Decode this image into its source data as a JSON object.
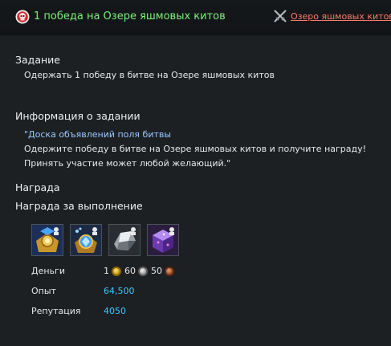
{
  "header": {
    "title": "1 победа на Озере яшмовых китов",
    "location_link": "Озеро яшмовых китов",
    "title_icon": "red-skull-icon",
    "location_icon": "crossed-swords-icon"
  },
  "objective": {
    "heading": "Задание",
    "text": "Одержать 1 победу в битве на Озере яшмовых китов"
  },
  "quest_info": {
    "heading": "Информация о задании",
    "link_text": "\"Доска объявлений поля битвы",
    "line2": "Одержите победу в битве на Озере яшмовых китов и получите награду!",
    "line3": "Принять участие может любой желающий.\""
  },
  "reward": {
    "heading": "Награда",
    "completion_heading": "Награда за выполнение",
    "items": [
      {
        "name": "gold-medal-chest-icon"
      },
      {
        "name": "blue-crest-chest-icon"
      },
      {
        "name": "silver-ore-icon"
      },
      {
        "name": "purple-cube-icon"
      }
    ],
    "money_label": "Деньги",
    "money": {
      "gold": "1",
      "silver": "60",
      "copper": "50"
    },
    "exp_label": "Опыт",
    "exp_value": "64,500",
    "rep_label": "Репутация",
    "rep_value": "4050"
  },
  "colors": {
    "title_green": "#7cf07a",
    "link_red": "#ff7b6a",
    "link_blue": "#9cc9ff",
    "value_cyan": "#3fc7ff",
    "background": "#1c2023"
  }
}
